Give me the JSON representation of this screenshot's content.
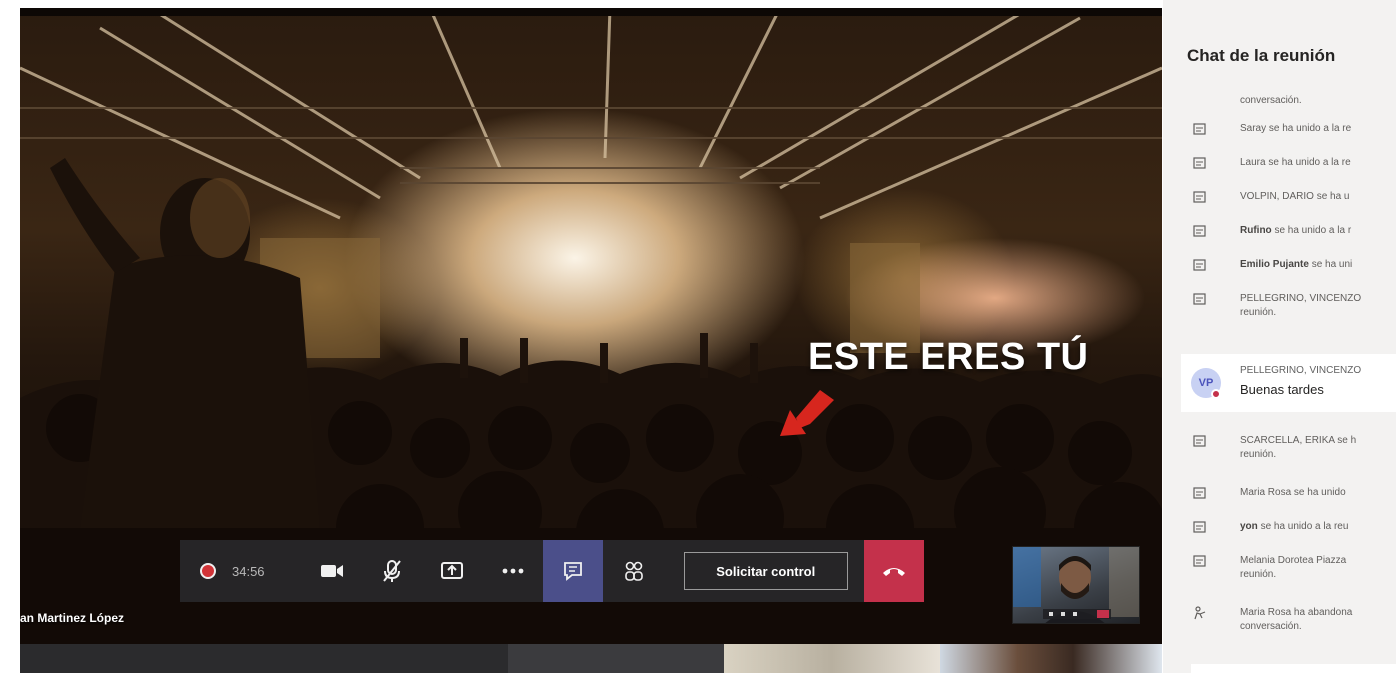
{
  "stage": {
    "overlay_text": "ESTE ERES TÚ",
    "participant_name": "an Martinez López"
  },
  "controls": {
    "recording_time": "34:56",
    "request_control_label": "Solicitar control",
    "items": [
      {
        "name": "camera-icon"
      },
      {
        "name": "microphone-muted-icon"
      },
      {
        "name": "share-screen-icon"
      },
      {
        "name": "more-options-icon"
      },
      {
        "name": "chat-icon",
        "active": true
      },
      {
        "name": "participants-icon"
      },
      {
        "name": "hang-up-icon"
      }
    ],
    "colors": {
      "bar": "#28282a",
      "active": "#4b4f8a",
      "hangup": "#c4314b",
      "record": "#d13438"
    }
  },
  "chat": {
    "title": "Chat de la reunión",
    "messages": [
      {
        "text": "conversación.",
        "icon": "none"
      },
      {
        "name": "Saray",
        "text": "se ha unido a la re",
        "icon": "join-icon"
      },
      {
        "name": "Laura",
        "text": "se ha unido a la re",
        "icon": "join-icon"
      },
      {
        "name": "VOLPIN, DARIO",
        "text": "se ha u",
        "icon": "join-icon"
      },
      {
        "name": "Rufino",
        "text": "se ha unido a la r",
        "icon": "join-icon"
      },
      {
        "name": "Emilio Pujante",
        "text": "se ha uni",
        "icon": "join-icon"
      },
      {
        "name": "PELLEGRINO, VINCENZO",
        "text": "",
        "line2": "reunión.",
        "icon": "join-icon"
      },
      {
        "name": "SCARCELLA, ERIKA",
        "text": "se h",
        "line2": "reunión.",
        "icon": "join-icon"
      },
      {
        "name": "Maria Rosa",
        "text": "se ha unido",
        "icon": "join-icon"
      },
      {
        "name": "yon",
        "text": "se ha unido a la reu",
        "icon": "join-icon"
      },
      {
        "name": "Melania Dorotea Piazza",
        "text": "",
        "line2": "reunión.",
        "icon": "join-icon"
      },
      {
        "name": "Maria Rosa",
        "text": "ha abandona",
        "line2": "conversación.",
        "icon": "leave-icon"
      }
    ],
    "bubble": {
      "initials": "VP",
      "sender": "PELLEGRINO, VINCENZO",
      "body": "Buenas tardes"
    }
  }
}
